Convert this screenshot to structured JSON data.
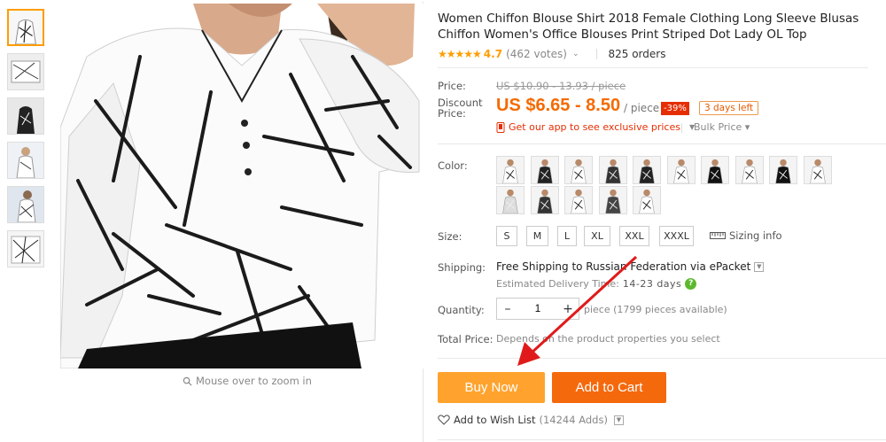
{
  "product": {
    "title": "Women Chiffon Blouse Shirt 2018 Female Clothing Long Sleeve Blusas Chiffon Women's Office Blouses Print Striped Dot Lady OL Top",
    "stars": "★★★★★",
    "rating": "4.7",
    "votes": "(462 votes)",
    "orders": "825 orders"
  },
  "gallery": {
    "zoom_hint": "Mouse over to zoom in",
    "thumbnail_count": 6
  },
  "price": {
    "label": "Price:",
    "original": "US $10.90 - 13.93 / piece",
    "discount_label_line1": "Discount",
    "discount_label_line2": "Price:",
    "current": "US $6.65 - 8.50",
    "per": "/ piece",
    "discount_badge": "-39%",
    "days_left": "3 days left",
    "app_promo": "Get our app to see exclusive prices",
    "bulk_price": "Bulk Price ▾"
  },
  "options": {
    "color_label": "Color:",
    "color_count": 15,
    "size_label": "Size:",
    "sizes": [
      "S",
      "M",
      "L",
      "XL",
      "XXL",
      "XXXL"
    ],
    "sizing_info": "Sizing info"
  },
  "shipping": {
    "label": "Shipping:",
    "text": "Free Shipping to Russian Federation via ePacket",
    "delivery_prefix": "Estimated Delivery Time:",
    "delivery_days": "14-23 days",
    "help_icon": "?"
  },
  "quantity": {
    "label": "Quantity:",
    "value": "1",
    "minus": "–",
    "plus": "+",
    "info": "piece (1799 pieces available)"
  },
  "total": {
    "label": "Total Price:",
    "text": "Depends on the product properties you select"
  },
  "actions": {
    "buy_now": "Buy Now",
    "add_to_cart": "Add to Cart",
    "wishlist": "Add to Wish List",
    "wishlist_adds": "(14244 Adds)"
  },
  "colors": {
    "accent_orange": "#f56a00",
    "buy_now_bg": "#ffa32e",
    "add_cart_bg": "#f5690d",
    "discount_red": "#e62e04",
    "star": "#ff9d00",
    "annotation_arrow": "#e01a1a"
  }
}
